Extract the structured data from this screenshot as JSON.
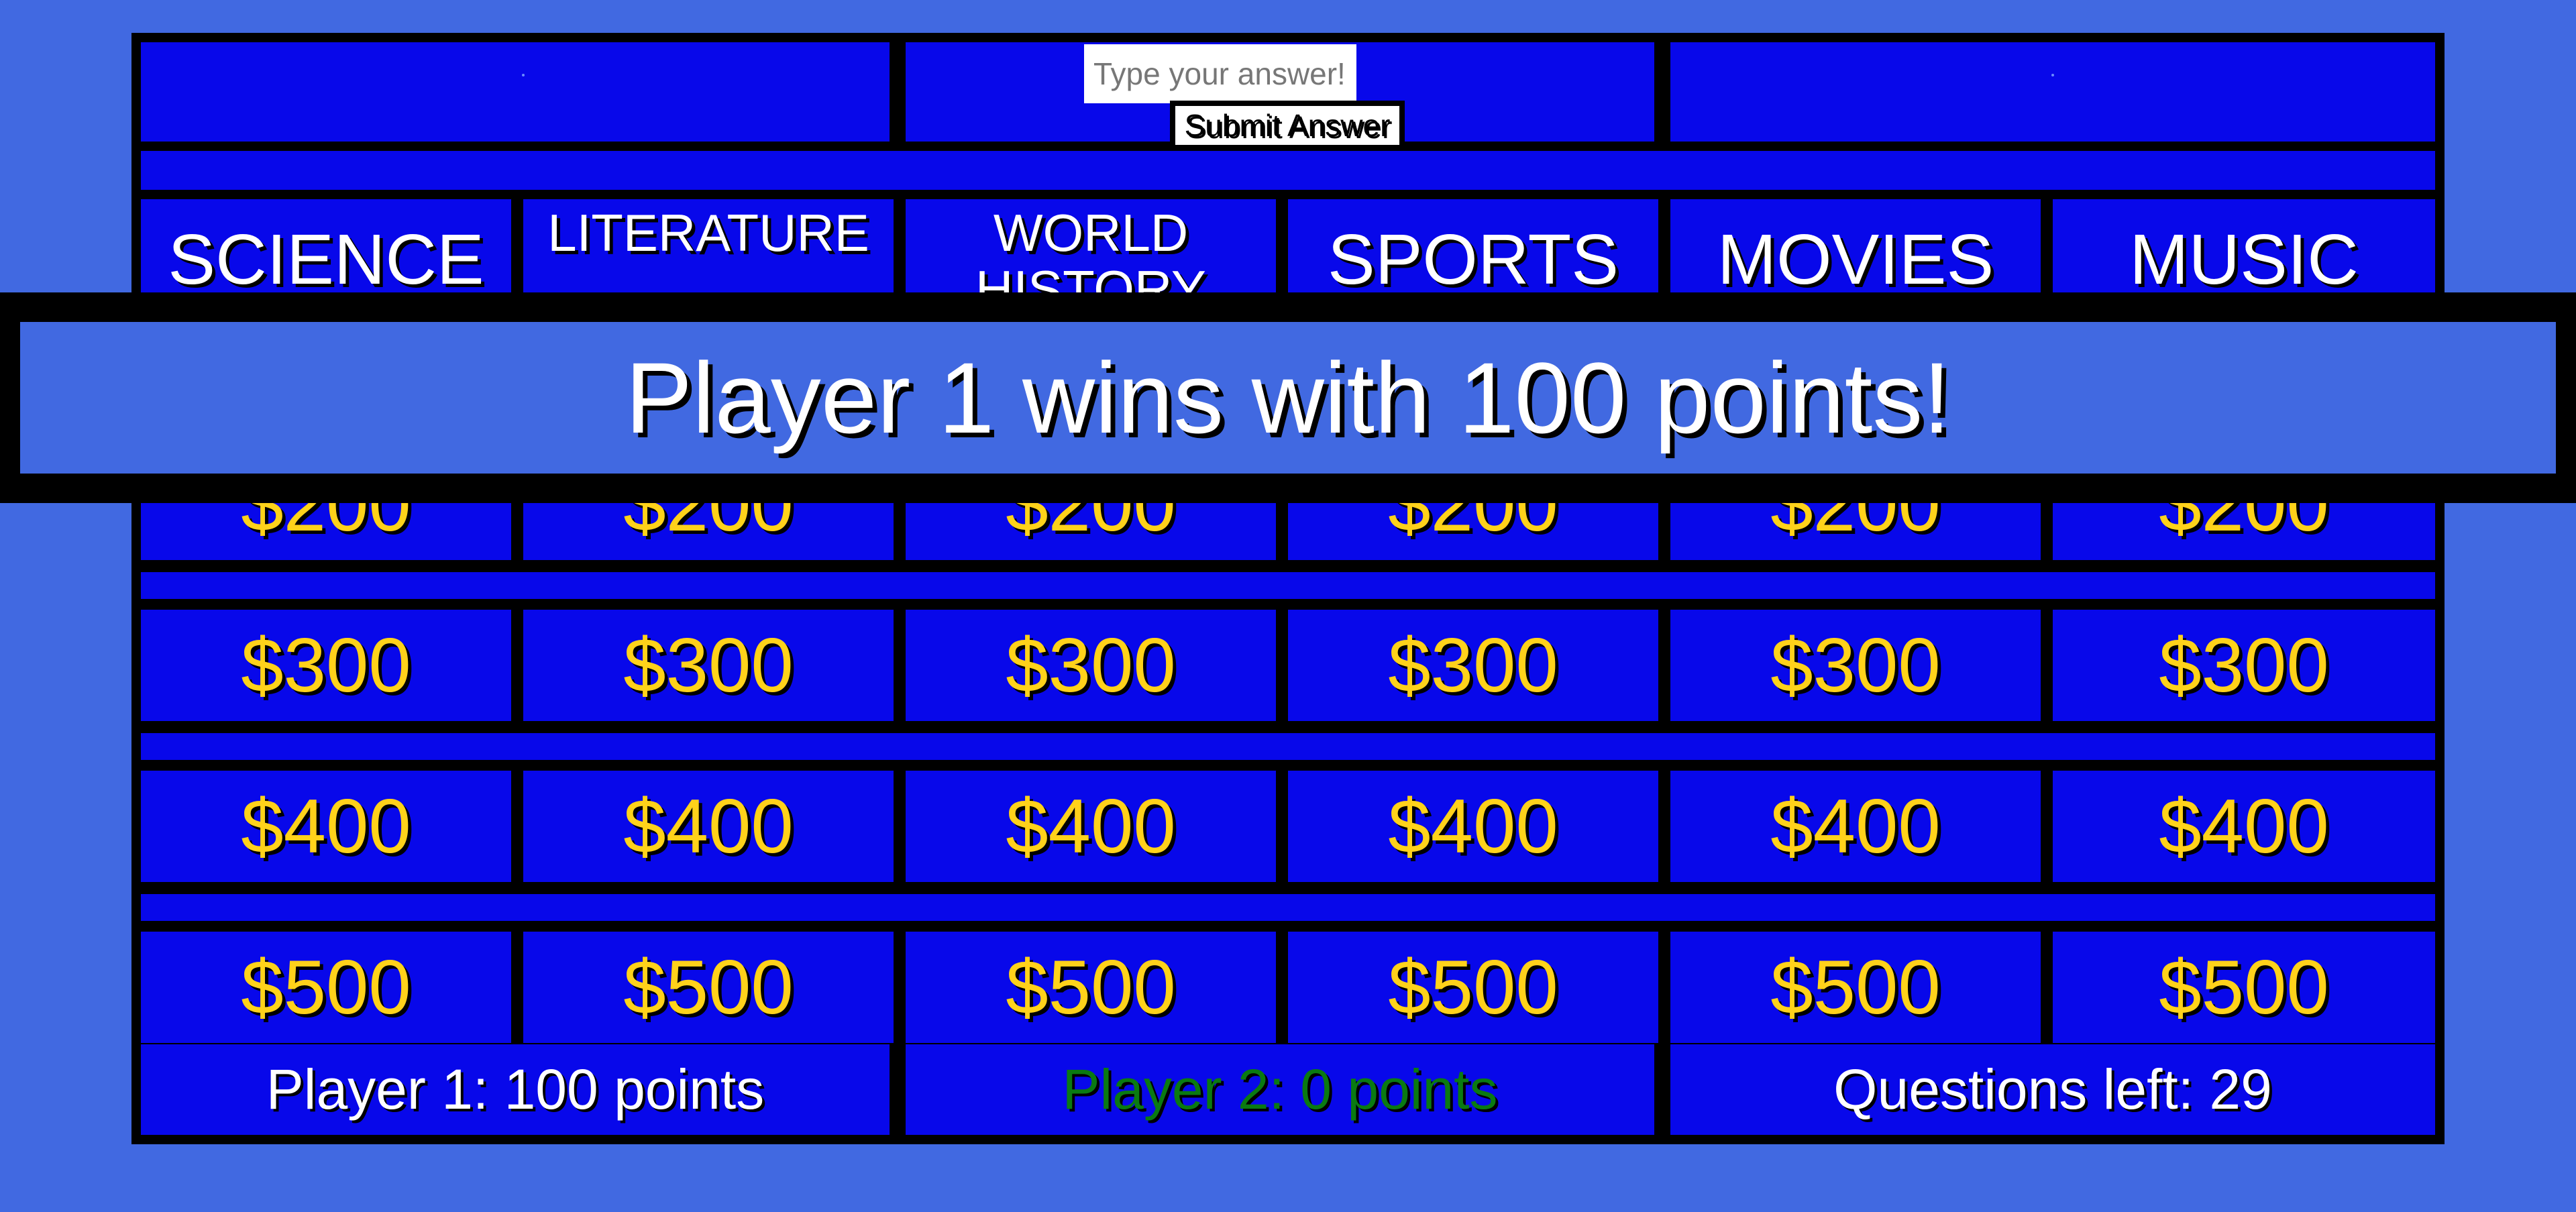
{
  "answer": {
    "placeholder": "Type your answer!",
    "value": ""
  },
  "submit_label": "Submit Answer",
  "categories": [
    "SCIENCE",
    "LITERATURE",
    "WORLD HISTORY",
    "SPORTS",
    "MOVIES",
    "MUSIC"
  ],
  "values": [
    "$200",
    "$300",
    "$400",
    "$500"
  ],
  "scores": {
    "player1": "Player 1: 100 points",
    "player2": "Player 2: 0 points",
    "questions_left": "Questions left: 29"
  },
  "winner_message": "Player 1 wins with 100 points!",
  "colors": {
    "background": "#4169e1",
    "cell": "#0808ea",
    "money": "#ffd21a",
    "player2_text": "#0a7a12",
    "border": "#000000"
  }
}
